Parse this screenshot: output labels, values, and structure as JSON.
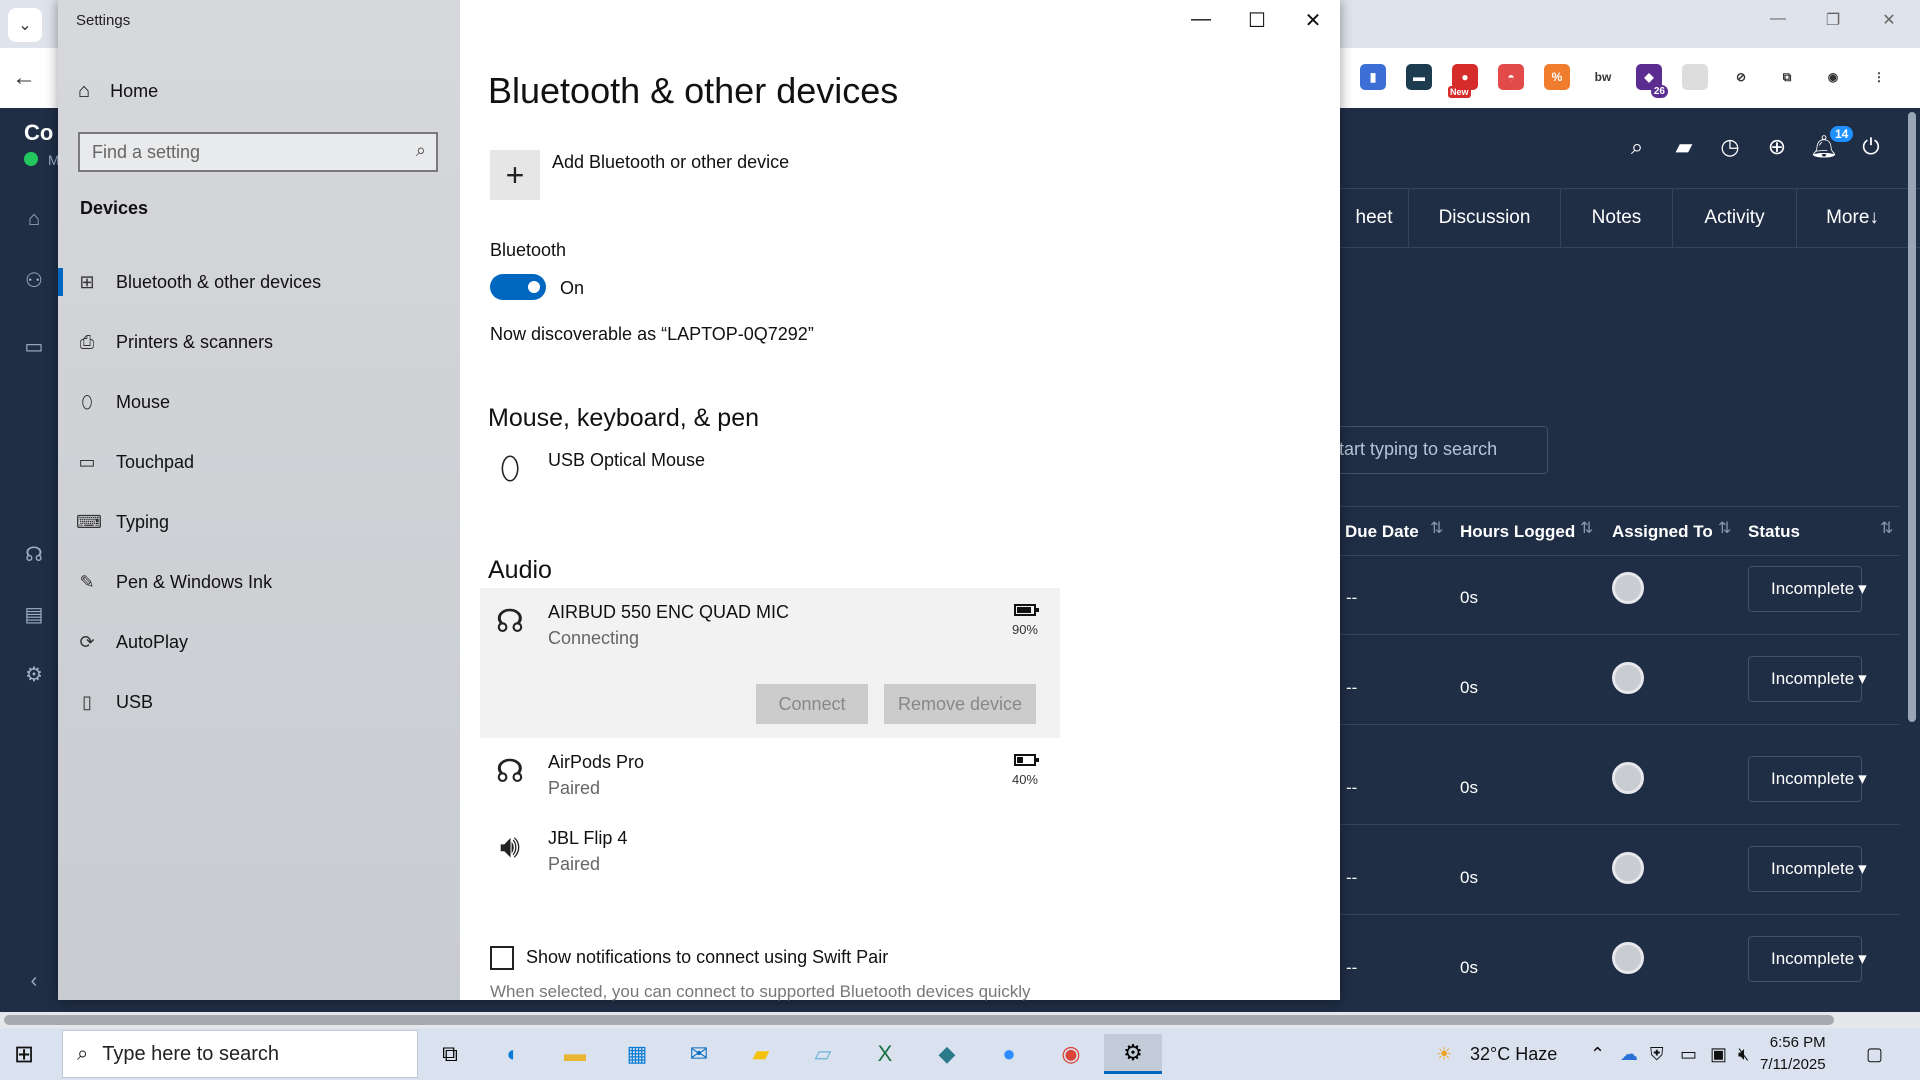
{
  "browser": {
    "extensions": [
      {
        "name": "clipboard-ext-icon",
        "color": "#3b6fd6",
        "glyph": "▮"
      },
      {
        "name": "folder-ext-icon",
        "color": "#1d3c4f",
        "glyph": "▬"
      },
      {
        "name": "new-ext-icon",
        "color": "#d62b2b",
        "glyph": "●",
        "badge": "New"
      },
      {
        "name": "pokeball-ext-icon",
        "color": "#e34b4b",
        "glyph": "◓"
      },
      {
        "name": "percent-ext-icon",
        "color": "#f07d2e",
        "glyph": "%"
      },
      {
        "name": "bw-ext-icon",
        "color": "#ffffff",
        "glyph": "bw"
      },
      {
        "name": "cap-ext-icon",
        "color": "#5b2d91",
        "glyph": "◆",
        "count": "26"
      },
      {
        "name": "blank-ext-icon",
        "color": "#dddddd",
        "glyph": ""
      },
      {
        "name": "compass-ext-icon",
        "color": "#ffffff",
        "glyph": "⊘"
      },
      {
        "name": "puzzle-ext-icon",
        "color": "#ffffff",
        "glyph": "⧉"
      },
      {
        "name": "profile-icon",
        "color": "#ffffff",
        "glyph": "◉"
      },
      {
        "name": "menu-icon",
        "color": "#ffffff",
        "glyph": "⋮"
      }
    ]
  },
  "app": {
    "notification_count": "14",
    "tabs": [
      {
        "label": "heet"
      },
      {
        "label": "Discussion"
      },
      {
        "label": "Notes"
      },
      {
        "label": "Activity"
      },
      {
        "label": "More↓"
      }
    ],
    "search_placeholder": "tart typing to search",
    "columns": [
      "Due Date",
      "Hours Logged",
      "Assigned To",
      "Status"
    ],
    "rows": [
      {
        "due": "--",
        "hours": "0s",
        "status": "Incomplete"
      },
      {
        "due": "--",
        "hours": "0s",
        "status": "Incomplete"
      },
      {
        "due": "--",
        "hours": "0s",
        "status": "Incomplete"
      },
      {
        "due": "--",
        "hours": "0s",
        "status": "Incomplete"
      },
      {
        "due": "--",
        "hours": "0s",
        "status": "Incomplete"
      }
    ],
    "status_color": "#e0202a",
    "left_rail_text": "Co",
    "left_rail_sub": "M"
  },
  "settings": {
    "window_title": "Settings",
    "home_label": "Home",
    "search_placeholder": "Find a setting",
    "section": "Devices",
    "nav": [
      {
        "label": "Bluetooth & other devices",
        "icon": "bluetooth-devices-icon",
        "glyph": "⊞"
      },
      {
        "label": "Printers & scanners",
        "icon": "printer-icon",
        "glyph": "⎙"
      },
      {
        "label": "Mouse",
        "icon": "mouse-icon",
        "glyph": "⬯"
      },
      {
        "label": "Touchpad",
        "icon": "touchpad-icon",
        "glyph": "▭"
      },
      {
        "label": "Typing",
        "icon": "keyboard-icon",
        "glyph": "⌨"
      },
      {
        "label": "Pen & Windows Ink",
        "icon": "pen-icon",
        "glyph": "✎"
      },
      {
        "label": "AutoPlay",
        "icon": "autoplay-icon",
        "glyph": "⟳"
      },
      {
        "label": "USB",
        "icon": "usb-icon",
        "glyph": "▯"
      }
    ],
    "page_title": "Bluetooth & other devices",
    "add_device_label": "Add Bluetooth or other device",
    "bluetooth_label": "Bluetooth",
    "bluetooth_state": "On",
    "discoverable_text": "Now discoverable as “LAPTOP-0Q7292”",
    "mouse_section": "Mouse, keyboard, & pen",
    "mouse_device": "USB Optical Mouse",
    "audio_section": "Audio",
    "audio_devices": [
      {
        "name": "AIRBUD 550 ENC QUAD MIC",
        "status": "Connecting",
        "battery": "90%",
        "battery_level": 0.9
      },
      {
        "name": "AirPods Pro",
        "status": "Paired",
        "battery": "40%",
        "battery_level": 0.4
      },
      {
        "name": "JBL Flip 4",
        "status": "Paired"
      }
    ],
    "connect_label": "Connect",
    "remove_label": "Remove device",
    "swift_pair_label": "Show notifications to connect using Swift Pair",
    "swift_pair_hint": "When selected, you can connect to supported Bluetooth devices quickly",
    "accent": "#0067c0"
  },
  "taskbar": {
    "search_placeholder": "Type here to search",
    "weather": "32°C  Haze",
    "weather_badge": "1",
    "time": "6:56 PM",
    "date": "7/11/2025"
  }
}
